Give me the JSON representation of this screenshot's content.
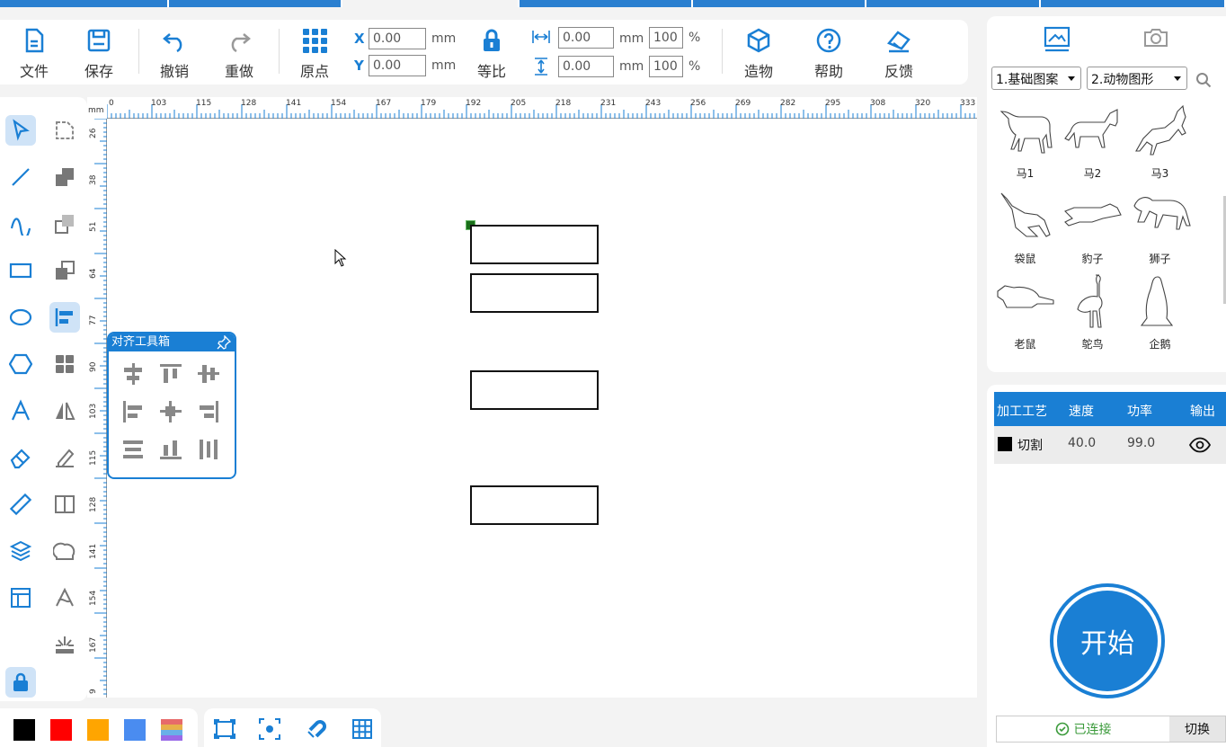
{
  "toolbar": {
    "file": "文件",
    "save": "保存",
    "undo": "撤销",
    "redo": "重做",
    "origin": "原点",
    "x_label": "X",
    "y_label": "Y",
    "x_value": "0.00",
    "y_value": "0.00",
    "unit": "mm",
    "ratio": "等比",
    "width_value": "0.00",
    "height_value": "0.00",
    "width_pct": "100",
    "height_pct": "100",
    "pct": "%",
    "build": "造物",
    "help": "帮助",
    "feedback": "反馈"
  },
  "ruler": {
    "unit": "mm",
    "h_ticks": [
      "0",
      "103",
      "115",
      "128",
      "141",
      "154",
      "167",
      "179",
      "192",
      "205",
      "218",
      "231",
      "243",
      "256",
      "269",
      "282",
      "295",
      "308",
      "320",
      "333"
    ],
    "v_ticks": [
      "26",
      "38",
      "51",
      "64",
      "77",
      "90",
      "103",
      "115",
      "128",
      "141",
      "154",
      "167",
      "9"
    ]
  },
  "align_toolbox": {
    "title": "对齐工具箱"
  },
  "library": {
    "category1": "1.基础图案",
    "category2": "2.动物图形",
    "items": [
      "马1",
      "马2",
      "马3",
      "袋鼠",
      "豹子",
      "狮子",
      "老鼠",
      "鸵鸟",
      "企鹅"
    ]
  },
  "process": {
    "headers": [
      "加工工艺",
      "速度",
      "功率",
      "输出"
    ],
    "row": {
      "name": "切割",
      "speed": "40.0",
      "power": "99.0",
      "color": "#000000"
    }
  },
  "start_label": "开始",
  "status": {
    "connected": "已连接",
    "switch": "切换"
  },
  "colors": [
    "#000000",
    "#ff0000",
    "#ffa500",
    "#4a8cf0"
  ],
  "accent": "#1a7fd4"
}
